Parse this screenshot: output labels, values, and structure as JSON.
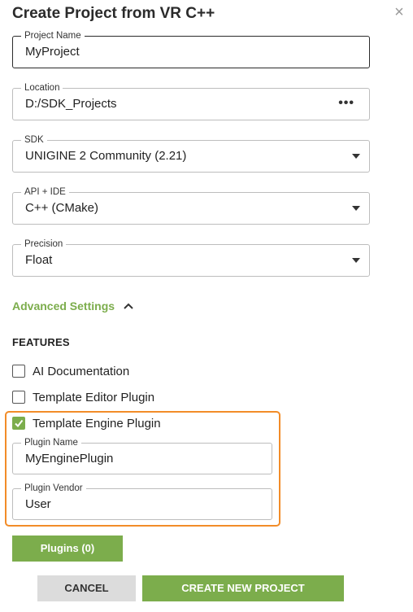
{
  "dialog": {
    "title": "Create Project from VR C++",
    "close_glyph": "×"
  },
  "fields": {
    "project_name": {
      "label": "Project Name",
      "value": "MyProject"
    },
    "location": {
      "label": "Location",
      "value": "D:/SDK_Projects",
      "browse_glyph": "•••"
    },
    "sdk": {
      "label": "SDK",
      "value": "UNIGINE 2 Community (2.21)"
    },
    "api_ide": {
      "label": "API + IDE",
      "value": "C++ (CMake)"
    },
    "precision": {
      "label": "Precision",
      "value": "Float"
    }
  },
  "advanced": {
    "label": "Advanced Settings",
    "expanded": true
  },
  "features": {
    "heading": "FEATURES",
    "items": [
      {
        "label": "AI Documentation",
        "checked": false
      },
      {
        "label": "Template Editor Plugin",
        "checked": false
      },
      {
        "label": "Template Engine Plugin",
        "checked": true
      }
    ],
    "plugin_name": {
      "label": "Plugin Name",
      "value": "MyEnginePlugin"
    },
    "plugin_vendor": {
      "label": "Plugin Vendor",
      "value": "User"
    }
  },
  "buttons": {
    "plugins": "Plugins (0)",
    "cancel": "CANCEL",
    "create": "CREATE NEW PROJECT"
  },
  "colors": {
    "accent": "#7cad4c",
    "highlight": "#f28c28"
  }
}
